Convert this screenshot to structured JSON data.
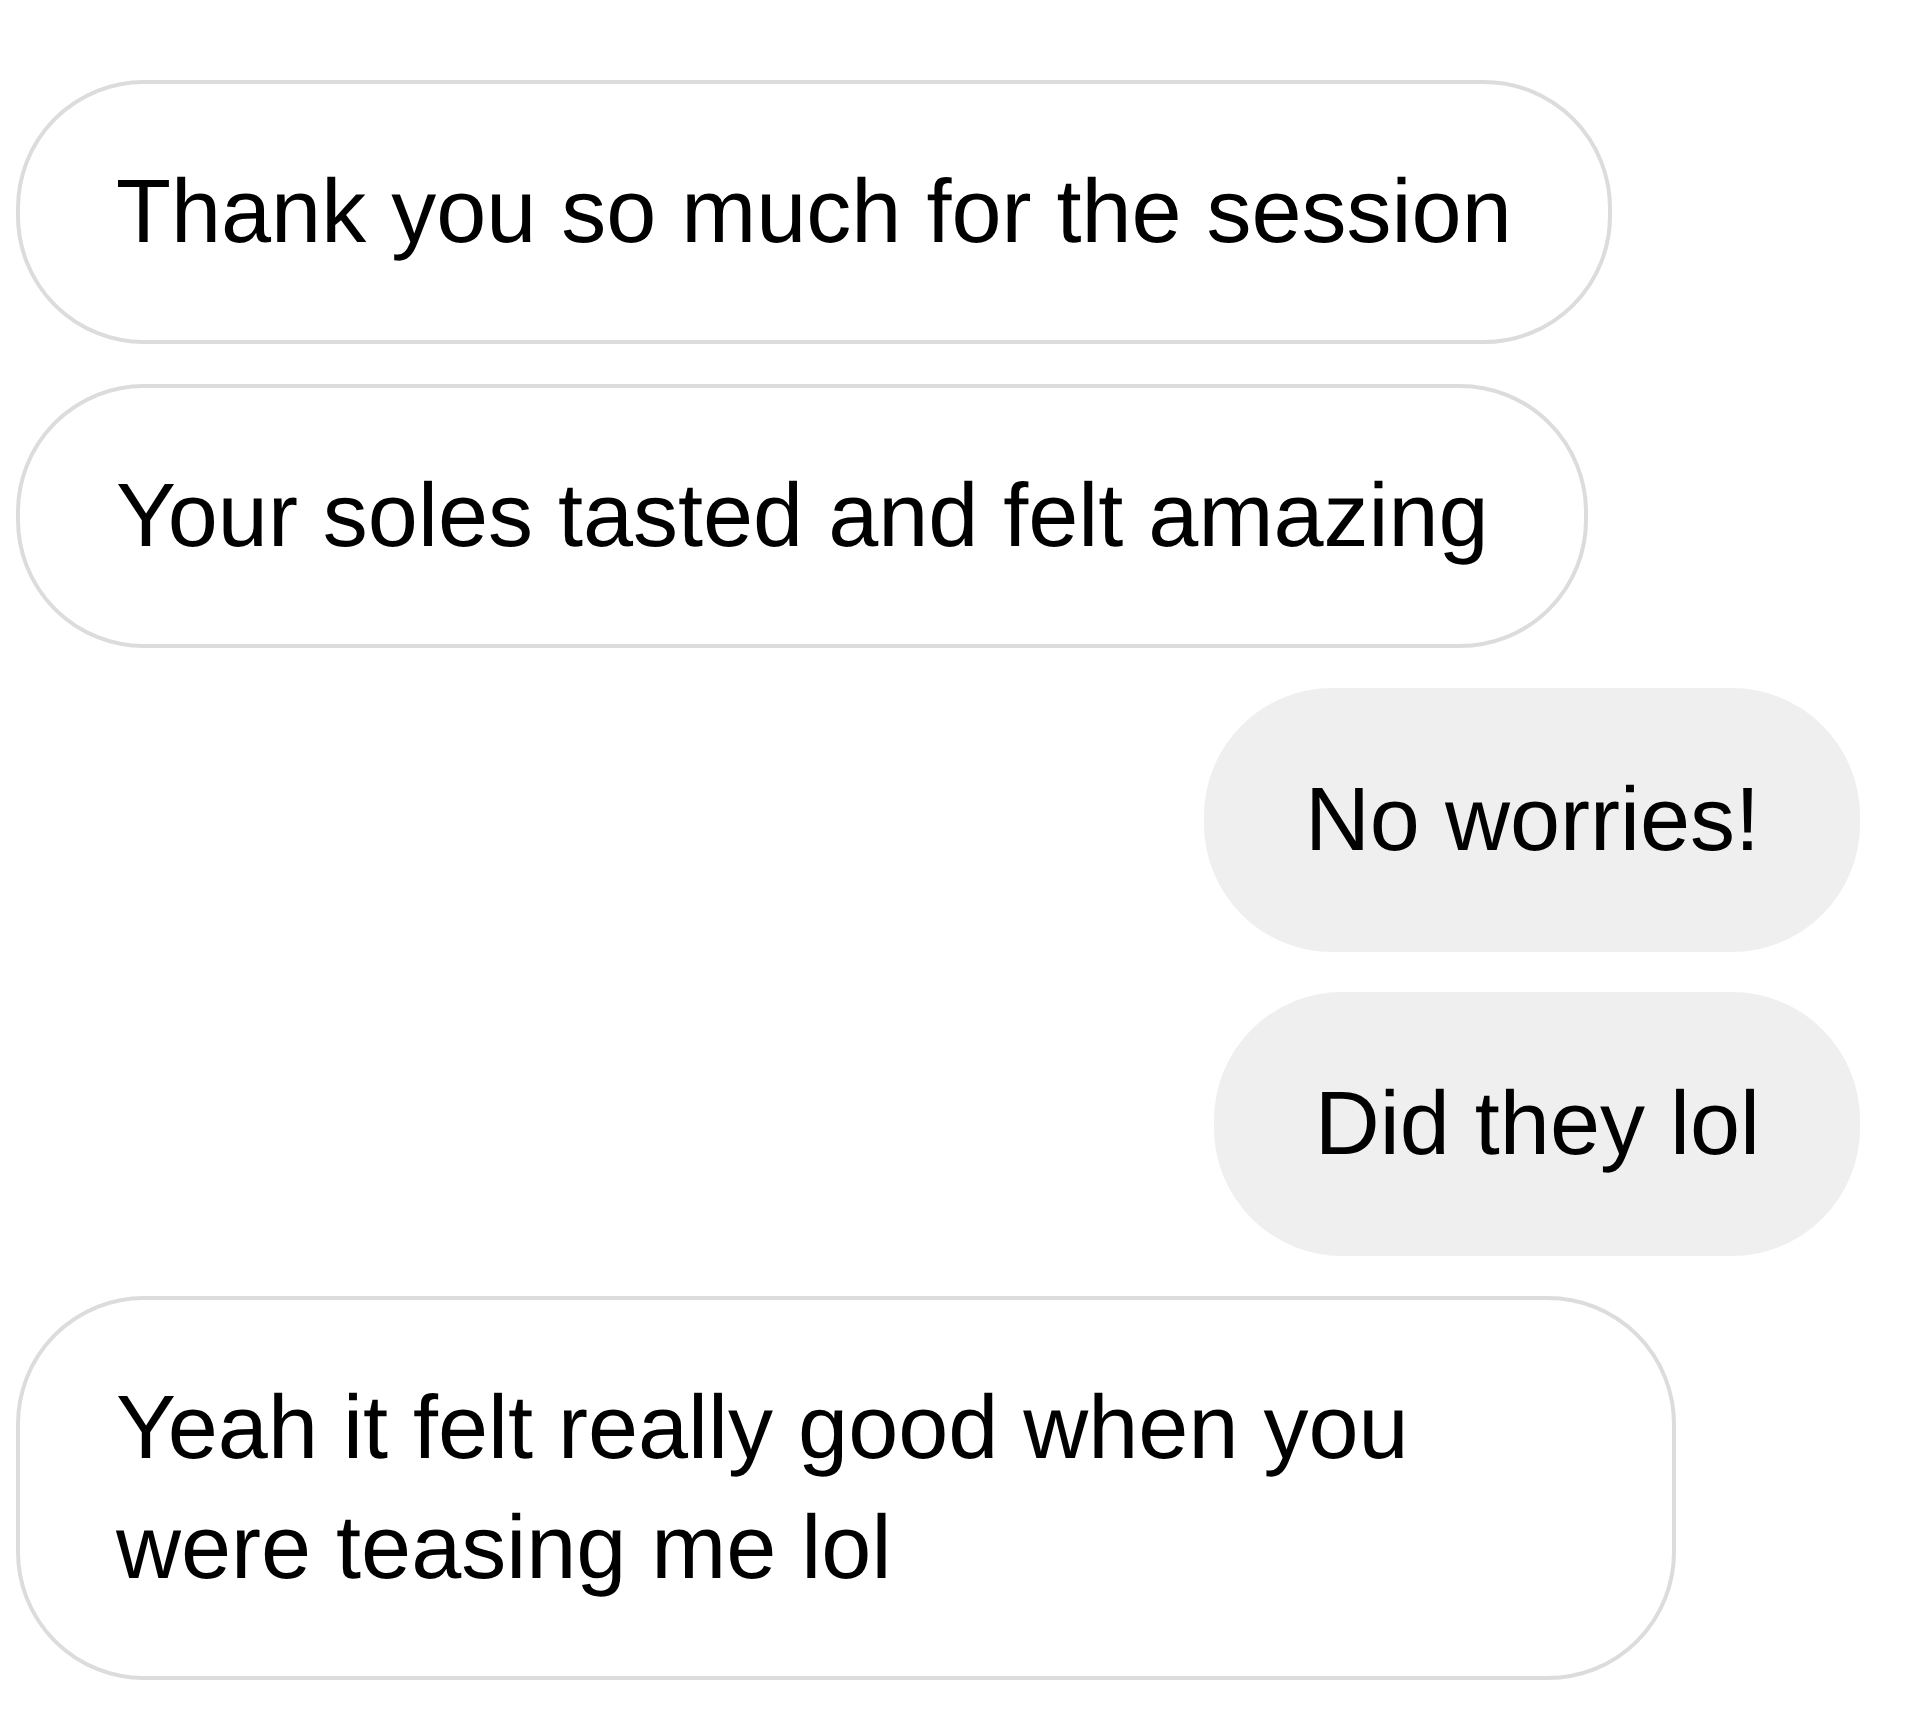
{
  "messages": [
    {
      "text": "Thank you so much for the session",
      "kind": "incoming"
    },
    {
      "text": "Your soles tasted and felt amazing",
      "kind": "incoming"
    },
    {
      "text": "No worries!",
      "kind": "outgoing"
    },
    {
      "text": "Did they lol",
      "kind": "outgoing"
    },
    {
      "text": "Yeah it felt really good when you were teasing me lol",
      "kind": "incoming"
    }
  ]
}
